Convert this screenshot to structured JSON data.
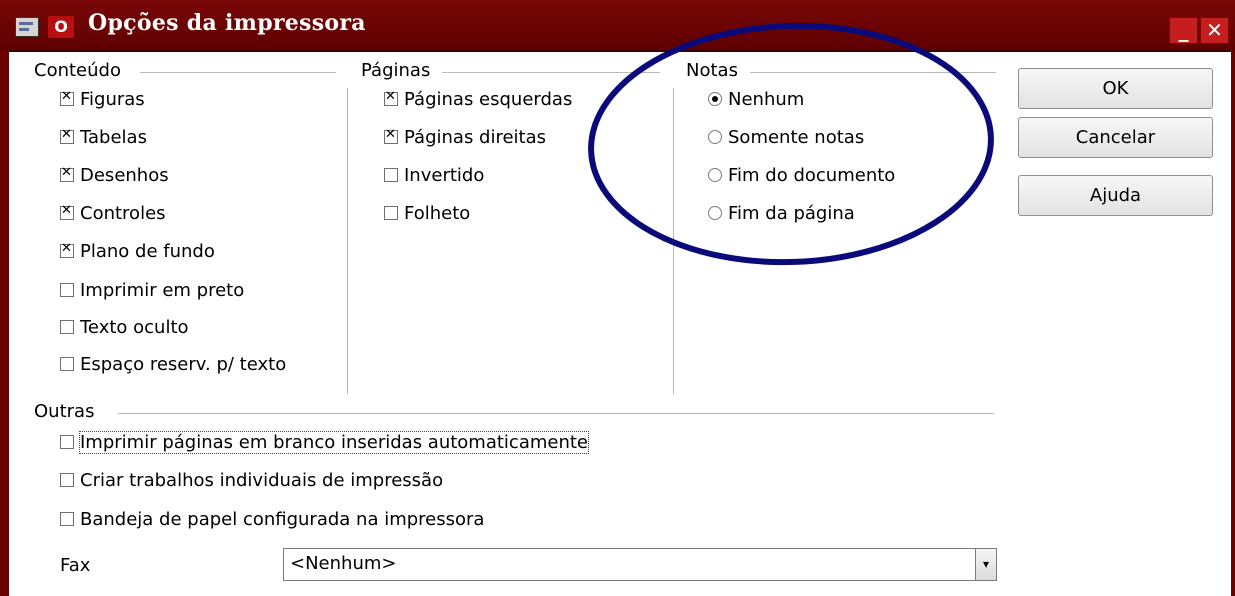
{
  "window": {
    "title": "Opções da impressora",
    "app_icon_glyph": "O",
    "minimize_glyph": "_",
    "close_glyph": "✕",
    "titlebar_color": "#6a0000"
  },
  "groups": {
    "conteudo": {
      "label": "Conteúdo",
      "items": [
        {
          "label": "Figuras",
          "checked": true
        },
        {
          "label": "Tabelas",
          "checked": true
        },
        {
          "label": "Desenhos",
          "checked": true
        },
        {
          "label": "Controles",
          "checked": true
        },
        {
          "label": "Plano de fundo",
          "checked": true
        },
        {
          "label": "Imprimir em preto",
          "checked": false
        },
        {
          "label": "Texto oculto",
          "checked": false
        },
        {
          "label": "Espaço reserv. p/ texto",
          "checked": false
        }
      ]
    },
    "paginas": {
      "label": "Páginas",
      "items": [
        {
          "label": "Páginas esquerdas",
          "checked": true
        },
        {
          "label": "Páginas direitas",
          "checked": true
        },
        {
          "label": "Invertido",
          "checked": false
        },
        {
          "label": "Folheto",
          "checked": false
        }
      ]
    },
    "notas": {
      "label": "Notas",
      "items": [
        {
          "label": "Nenhum",
          "selected": true
        },
        {
          "label": "Somente notas",
          "selected": false
        },
        {
          "label": "Fim do documento",
          "selected": false
        },
        {
          "label": "Fim da página",
          "selected": false
        }
      ]
    },
    "outras": {
      "label": "Outras",
      "items": [
        {
          "label": "Imprimir páginas em branco inseridas automaticamente",
          "checked": false
        },
        {
          "label": "Criar trabalhos individuais de impressão",
          "checked": false
        },
        {
          "label": "Bandeja de papel configurada na impressora",
          "checked": false
        }
      ]
    }
  },
  "fax": {
    "label": "Fax",
    "value": "<Nenhum>",
    "arrow_glyph": "▾"
  },
  "buttons": {
    "ok": "OK",
    "cancel": "Cancelar",
    "help": "Ajuda"
  },
  "annotation": {
    "color": "#0a0a7a",
    "icon": "highlight-ellipse"
  }
}
